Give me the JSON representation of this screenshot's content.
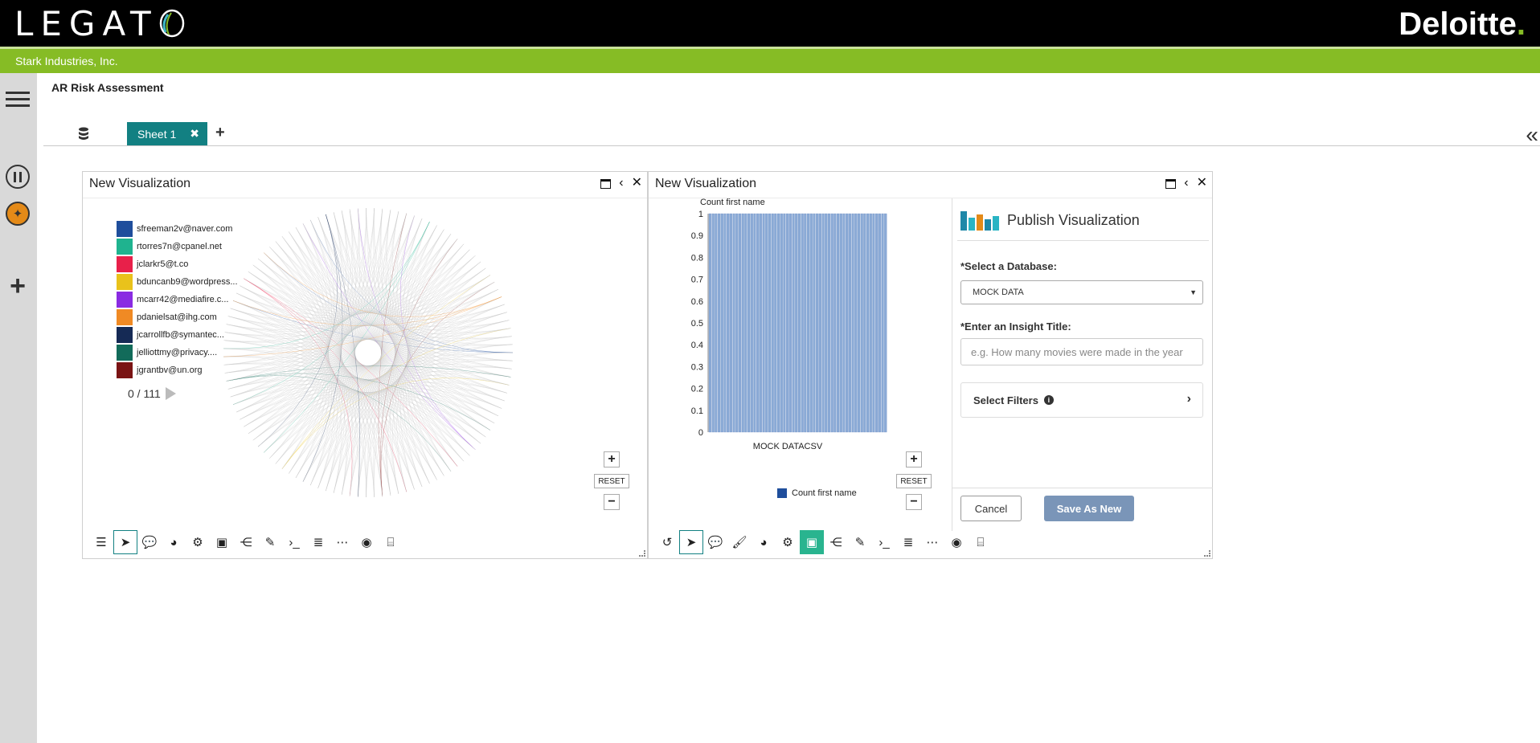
{
  "header": {
    "brand_left": "LEGATO",
    "brand_right": "Deloitte",
    "brand_right_dot": ".",
    "company": "Stark Industries, Inc."
  },
  "page": {
    "title": "AR Risk Assessment"
  },
  "tabs": [
    {
      "label": "Sheet 1",
      "close": "✖"
    }
  ],
  "add_tab": "+",
  "collapse": "«",
  "panels": [
    {
      "title": "New Visualization",
      "legend": [
        {
          "label": "sfreeman2v@naver.com",
          "color": "#1f4e9c"
        },
        {
          "label": "rtorres7n@cpanel.net",
          "color": "#1fb38f"
        },
        {
          "label": "jclarkr5@t.co",
          "color": "#e8204a"
        },
        {
          "label": "bduncanb9@wordpress...",
          "color": "#e9c21b"
        },
        {
          "label": "mcarr42@mediafire.c...",
          "color": "#8a2be2"
        },
        {
          "label": "pdanielsat@ihg.com",
          "color": "#f08a24"
        },
        {
          "label": "jcarrollfb@symantec...",
          "color": "#152a55"
        },
        {
          "label": "jelliottmy@privacy....",
          "color": "#126b5a"
        },
        {
          "label": "jgrantbv@un.org",
          "color": "#7a1414"
        }
      ],
      "pager": "0 / 111",
      "zoom": {
        "plus": "+",
        "reset": "RESET",
        "minus": "−"
      }
    },
    {
      "title": "New Visualization",
      "zoom": {
        "plus": "+",
        "reset": "RESET",
        "minus": "−"
      }
    }
  ],
  "chart_data": {
    "type": "bar",
    "title": "",
    "ylabel": "Count first name",
    "xlabel": "MOCK DATACSV",
    "ylim": [
      0,
      1
    ],
    "yticks": [
      "1",
      "0.9",
      "0.8",
      "0.7",
      "0.6",
      "0.5",
      "0.4",
      "0.3",
      "0.2",
      "0.1",
      "0"
    ],
    "series": [
      {
        "name": "Count first name",
        "values": [
          1,
          1,
          1,
          1,
          1,
          1,
          1,
          1,
          1,
          1,
          1,
          1,
          1,
          1,
          1,
          1,
          1,
          1,
          1,
          1,
          1,
          1,
          1,
          1,
          1,
          1,
          1,
          1,
          1,
          1,
          1,
          1,
          1,
          1,
          1,
          1,
          1,
          1,
          1,
          1,
          1,
          1,
          1,
          1,
          1,
          1,
          1,
          1,
          1,
          1,
          1,
          1,
          1,
          1,
          1,
          1,
          1,
          1,
          1,
          1
        ]
      }
    ],
    "legend_label": "Count first name",
    "color": "#8aaad6",
    "legend_color": "#1f4e9c"
  },
  "publish": {
    "title": "Publish Visualization",
    "db_label": "*Select a Database:",
    "db_value": "MOCK DATA",
    "title_label": "*Enter an Insight Title:",
    "title_placeholder": "e.g. How many movies were made in the year",
    "filters_label": "Select Filters",
    "cancel_label": "Cancel",
    "save_label": "Save As New"
  }
}
